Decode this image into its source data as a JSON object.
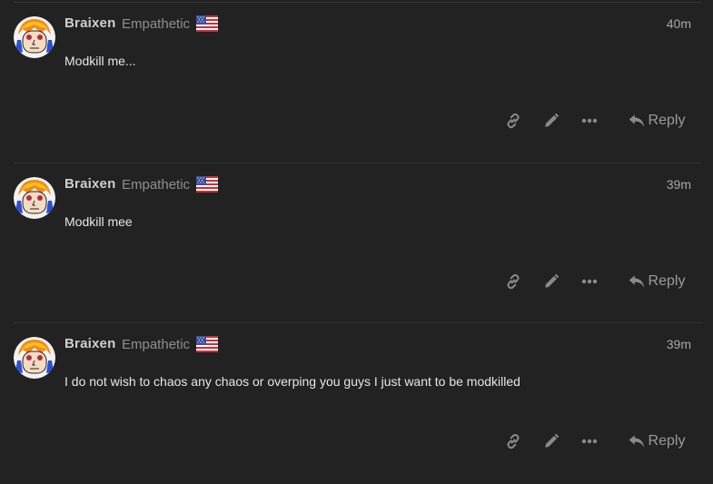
{
  "posts": [
    {
      "username": "Braixen",
      "user_title": "Empathetic",
      "time": "40m",
      "content": "Modkill me...",
      "reply_label": "Reply"
    },
    {
      "username": "Braixen",
      "user_title": "Empathetic",
      "time": "39m",
      "content": "Modkill mee",
      "reply_label": "Reply"
    },
    {
      "username": "Braixen",
      "user_title": "Empathetic",
      "time": "39m",
      "content": "I do not wish to chaos any chaos or overping you guys I just want to be modkilled",
      "reply_label": "Reply"
    }
  ],
  "icons": {
    "link": "link-icon",
    "edit": "pencil-icon",
    "more": "ellipsis-icon",
    "reply": "reply-arrow-icon",
    "flag": "us-flag-icon"
  },
  "colors": {
    "background": "#222222",
    "text": "#e6e6e6",
    "muted": "#8f8f8f",
    "icon": "#8a8a8a",
    "divider": "#333333"
  }
}
